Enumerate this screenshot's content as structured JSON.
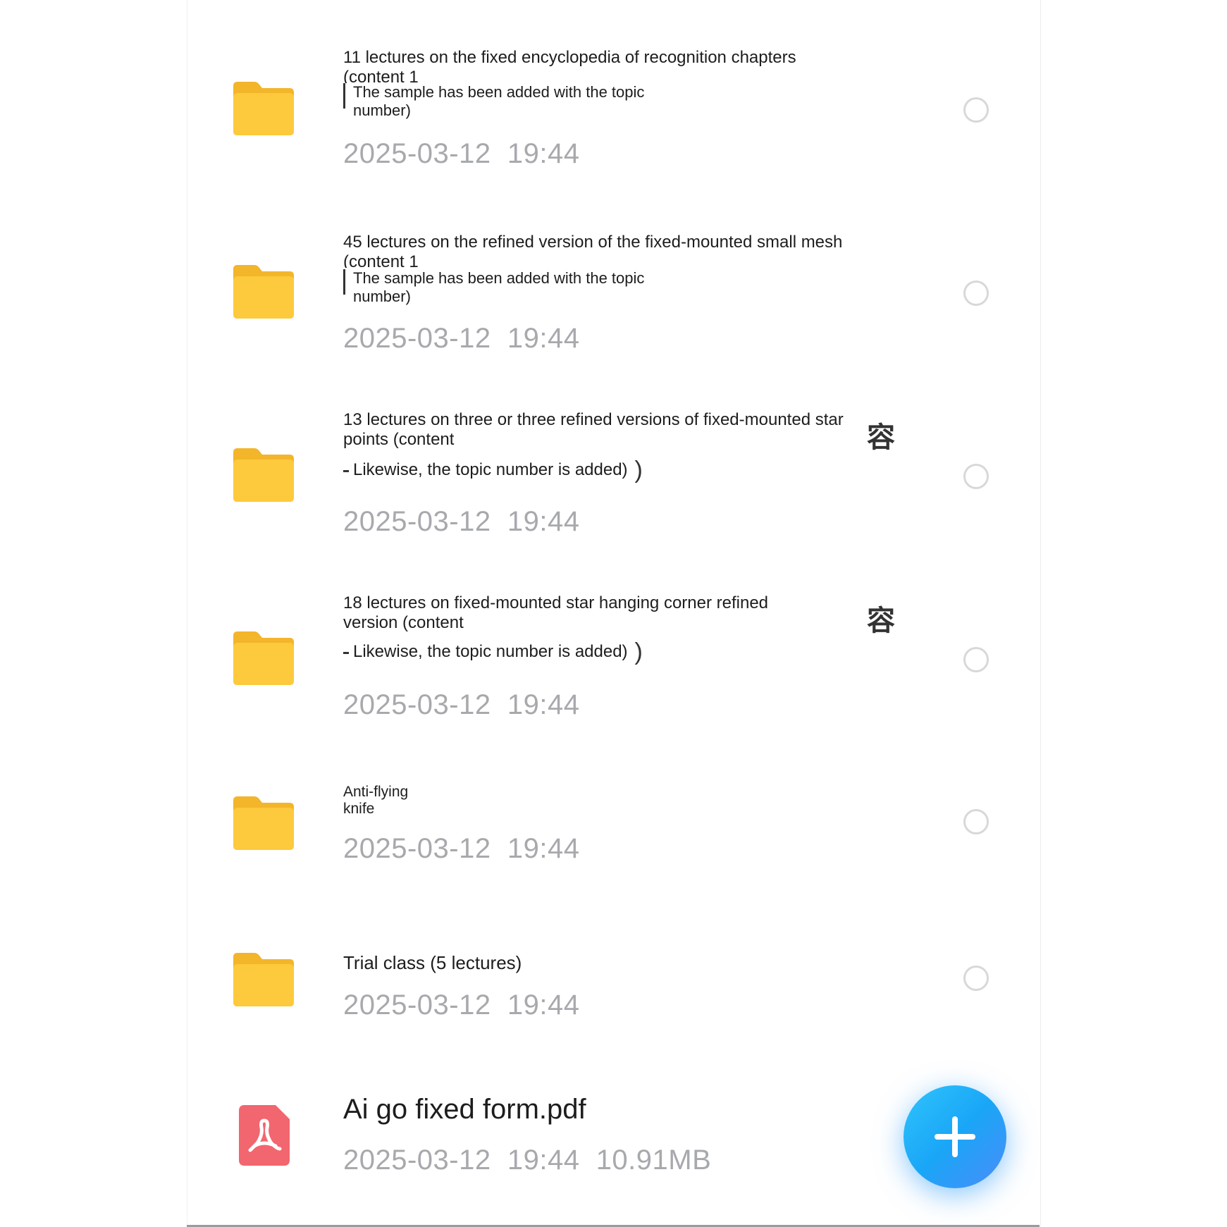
{
  "items": [
    {
      "type": "folder",
      "title": "11 lectures on the fixed encyclopedia of recognition chapters (content 1",
      "subtitle": "The sample has been added with the topic number)",
      "date": "2025-03-12",
      "time": "19:44"
    },
    {
      "type": "folder",
      "title": "45 lectures on the refined version of the fixed-mounted small mesh (content 1",
      "subtitle": "The sample has been added with the topic number)",
      "date": "2025-03-12",
      "time": "19:44"
    },
    {
      "type": "folder",
      "title": "13 lectures on three or three refined versions of fixed-mounted star points (content",
      "subtitle": "Likewise, the topic number is added)",
      "cjk": "容",
      "date": "2025-03-12",
      "time": "19:44"
    },
    {
      "type": "folder",
      "title": "18 lectures on fixed-mounted star hanging corner refined version (content",
      "subtitle": "Likewise, the topic number is added)",
      "cjk": "容",
      "date": "2025-03-12",
      "time": "19:44"
    },
    {
      "type": "folder",
      "title": "Anti-flying knife",
      "date": "2025-03-12",
      "time": "19:44"
    },
    {
      "type": "folder",
      "title": "Trial class (5 lectures)",
      "date": "2025-03-12",
      "time": "19:44"
    },
    {
      "type": "pdf",
      "title": "Ai go fixed form.pdf",
      "date": "2025-03-12",
      "time": "19:44",
      "size": "10.91MB"
    }
  ],
  "colors": {
    "folder": "#fcc63a",
    "pdf": "#f2666f",
    "fab": "#1aa6f7",
    "date_text": "#a7a9ad"
  },
  "icons": {
    "folder": "folder-icon",
    "pdf": "pdf-icon",
    "fab": "plus-icon"
  }
}
